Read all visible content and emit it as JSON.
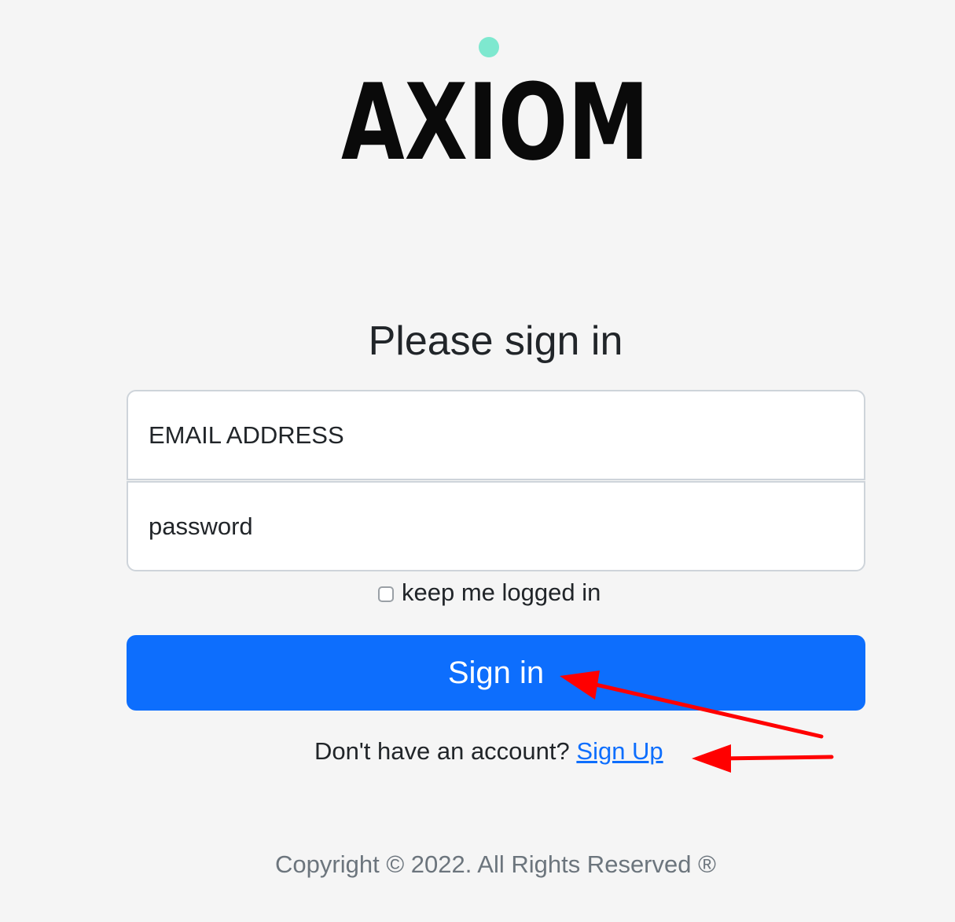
{
  "logo": {
    "text": "AXIOM",
    "dot_color": "#7ee8cf"
  },
  "form": {
    "heading": "Please sign in",
    "email_placeholder": "EMAIL ADDRESS",
    "password_placeholder": "password",
    "remember_label": "keep me logged in",
    "remember_checked": false,
    "submit_label": "Sign in"
  },
  "signup": {
    "prompt": "Don't have an account?",
    "link_label": "Sign Up"
  },
  "footer": {
    "copyright": "Copyright © 2022. All Rights Reserved ®"
  },
  "colors": {
    "background": "#f5f5f5",
    "primary": "#0d6efd",
    "annotation_arrow": "#ff0000"
  }
}
